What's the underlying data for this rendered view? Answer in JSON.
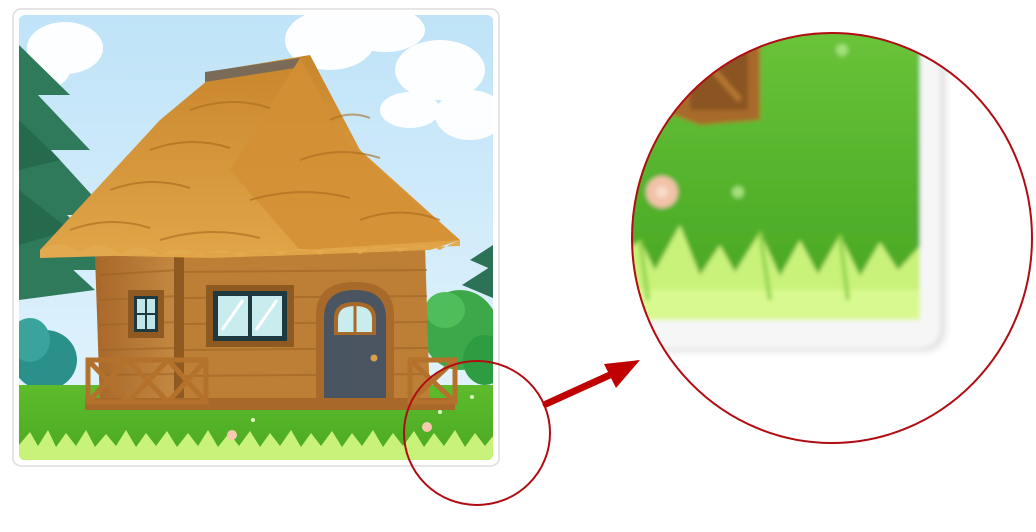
{
  "figure": {
    "kind": "zoom-inset-illustration",
    "subject": "thatched-roof-cabin-icon",
    "zoom_focus": "bottom-right-corner",
    "colors": {
      "circle_outline": "#b00c12",
      "arrow": "#c00000",
      "card_border": "#dddddd",
      "sky": "#cfe9f8",
      "grass": "#5fbd2e",
      "grass_tips": "#c9f27a",
      "roof": "#d99a3c",
      "wall": "#b4772f",
      "door": "#4a5561",
      "pine": "#2f7a5a"
    }
  }
}
